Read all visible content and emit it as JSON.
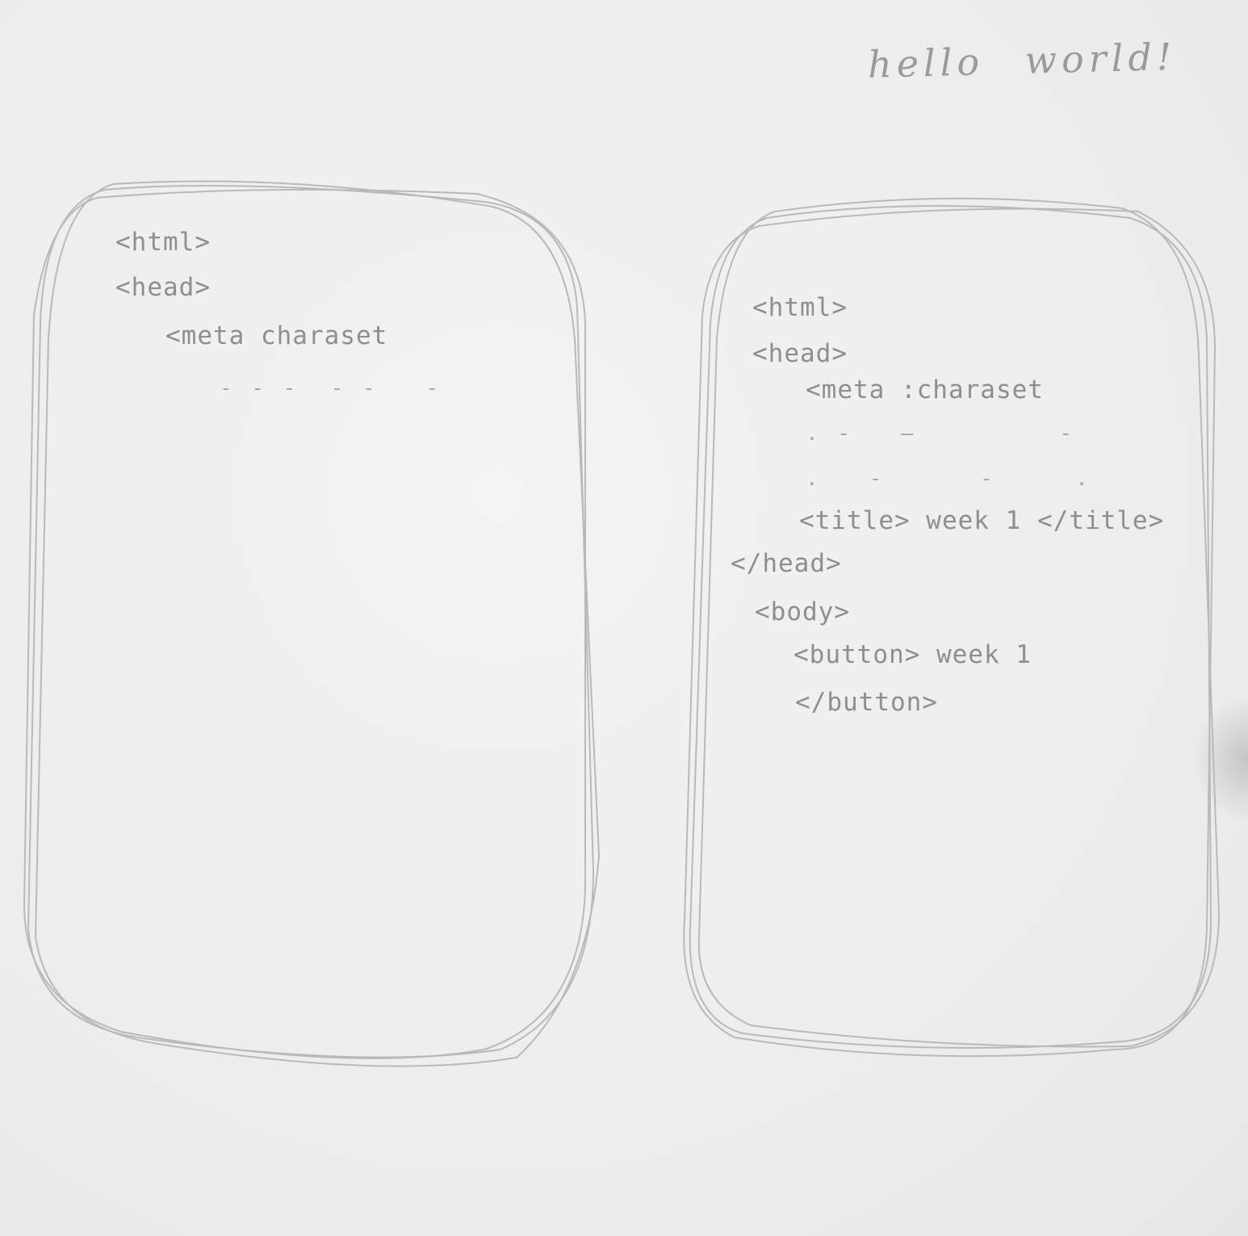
{
  "heading": "hello world!",
  "left_sketch": {
    "lines": [
      "<html>",
      "<head>",
      "<meta charaset"
    ]
  },
  "right_sketch": {
    "lines": [
      "<html>",
      "<head>",
      "<meta :charaset",
      "<title> week 1 </title>",
      "</head>",
      "<body>",
      "<button> week 1",
      "</button>"
    ]
  }
}
